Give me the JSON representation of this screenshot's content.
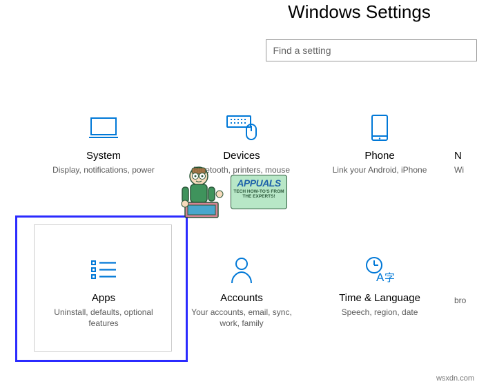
{
  "header": {
    "title": "Windows Settings"
  },
  "search": {
    "placeholder": "Find a setting"
  },
  "tiles": {
    "system": {
      "title": "System",
      "desc": "Display, notifications, power"
    },
    "devices": {
      "title": "Devices",
      "desc": "Bluetooth, printers, mouse"
    },
    "phone": {
      "title": "Phone",
      "desc": "Link your Android, iPhone"
    },
    "network": {
      "title": "N",
      "desc": "Wi"
    },
    "apps": {
      "title": "Apps",
      "desc": "Uninstall, defaults, optional features"
    },
    "accounts": {
      "title": "Accounts",
      "desc": "Your accounts, email, sync, work, family"
    },
    "time": {
      "title": "Time & Language",
      "desc": "Speech, region, date"
    },
    "gaming": {
      "title": "",
      "desc": "bro"
    }
  },
  "watermark": {
    "brand": "APPUALS",
    "tagline": "TECH HOW-TO'S FROM THE EXPERTS!"
  },
  "attribution": "wsxdn.com",
  "colors": {
    "accent": "#0078d7",
    "highlight": "#2b2bff"
  }
}
